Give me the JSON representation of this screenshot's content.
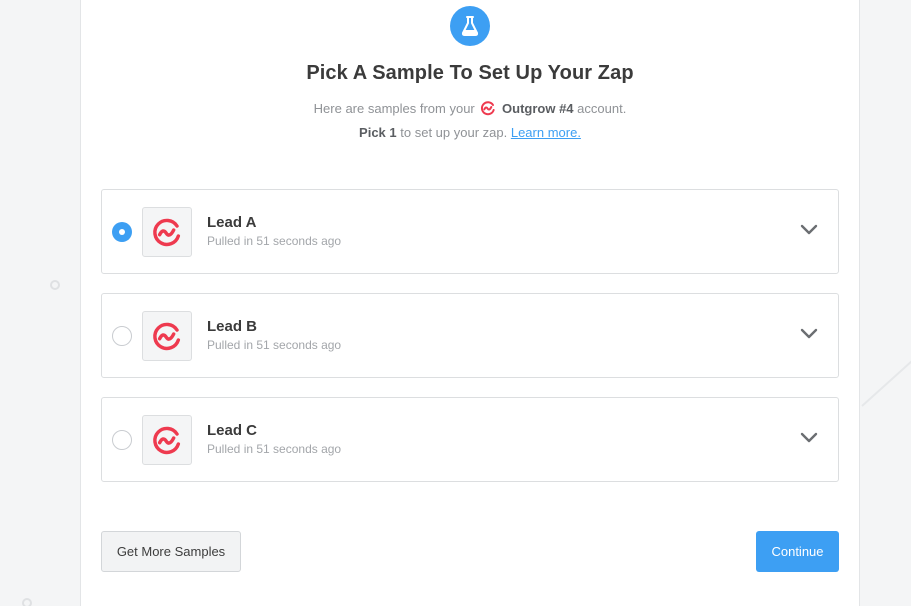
{
  "header": {
    "icon": "flask-icon",
    "title": "Pick A Sample To Set Up Your Zap",
    "subtitle_prefix": "Here are samples from your",
    "account_name": "Outgrow #4",
    "subtitle_suffix": "account.",
    "pick_count": "Pick 1",
    "pick_suffix": "to set up your zap.",
    "learn_more": "Learn more."
  },
  "samples": [
    {
      "name": "Lead A",
      "time": "Pulled in 51 seconds ago",
      "selected": true
    },
    {
      "name": "Lead B",
      "time": "Pulled in 51 seconds ago",
      "selected": false
    },
    {
      "name": "Lead C",
      "time": "Pulled in 51 seconds ago",
      "selected": false
    }
  ],
  "footer": {
    "get_more_label": "Get More Samples",
    "continue_label": "Continue"
  },
  "colors": {
    "accent": "#3d9ff3",
    "outgrow_brand": "#ee3a4f"
  }
}
